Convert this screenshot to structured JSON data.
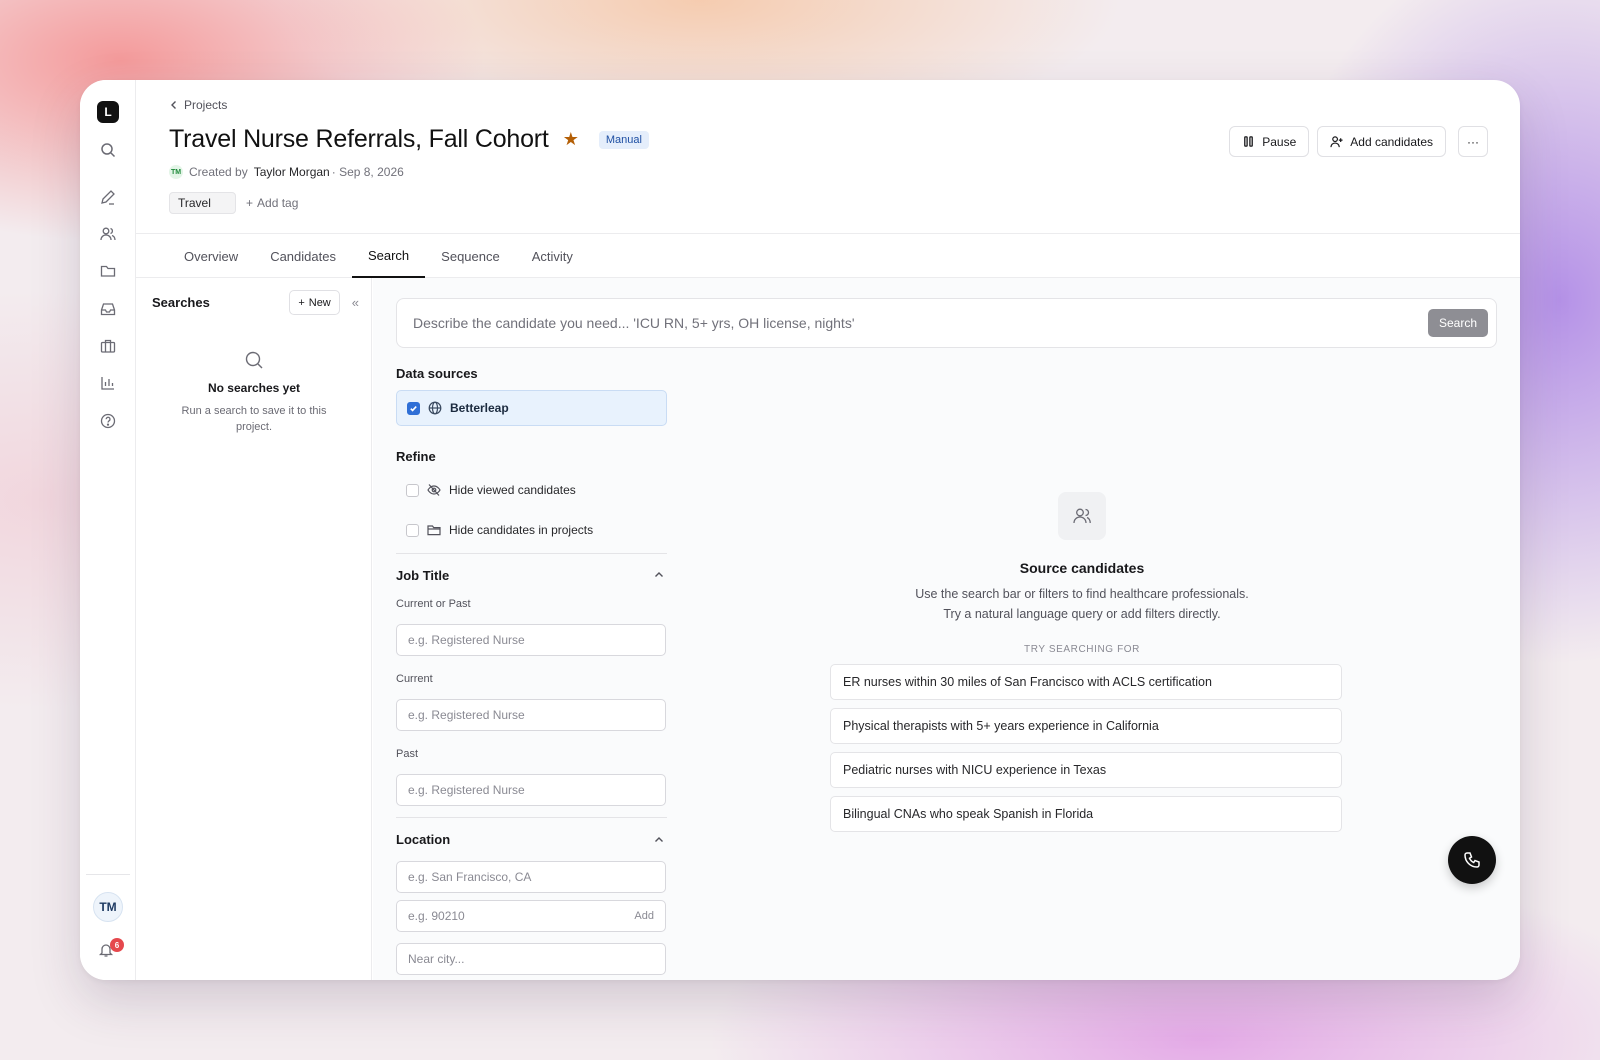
{
  "app": {
    "logo_letter": "L"
  },
  "rail": {
    "icons": [
      "search-icon",
      "pencil-icon",
      "users-icon",
      "folder-icon",
      "inbox-icon",
      "briefcase-icon",
      "bar-chart-icon",
      "help-icon"
    ],
    "user_initials": "TM",
    "notification_count": "6"
  },
  "header": {
    "breadcrumb": "Projects",
    "title": "Travel Nurse Referrals, Fall Cohort",
    "badge": "Manual",
    "creator_initials": "TM",
    "created_by_prefix": "Created by",
    "creator_name": "Taylor Morgan",
    "created_date": "· Sep 8, 2026",
    "tag": "Travel",
    "add_tag": "Add tag",
    "pause_label": "Pause",
    "add_candidates_label": "Add candidates",
    "more_label": "···"
  },
  "tabs": [
    {
      "label": "Overview",
      "active": false
    },
    {
      "label": "Candidates",
      "active": false
    },
    {
      "label": "Search",
      "active": true
    },
    {
      "label": "Sequence",
      "active": false
    },
    {
      "label": "Activity",
      "active": false
    }
  ],
  "searches": {
    "title": "Searches",
    "new_label": "New",
    "collapse_label": "«",
    "empty_title": "No searches yet",
    "empty_sub": "Run a search to save it to this project."
  },
  "search": {
    "placeholder": "Describe the candidate you need... 'ICU RN, 5+ yrs, OH license, nights'",
    "button": "Search"
  },
  "filters": {
    "data_sources_label": "Data sources",
    "source": {
      "label": "Betterleap",
      "checked": true
    },
    "refine_label": "Refine",
    "refine_options": [
      {
        "label": "Hide viewed candidates",
        "checked": false
      },
      {
        "label": "Hide candidates in projects",
        "checked": false
      }
    ],
    "job_title": {
      "label": "Job Title",
      "current_or_past_label": "Current or Past",
      "current_or_past_placeholder": "e.g. Registered Nurse",
      "current_label": "Current",
      "current_placeholder": "e.g. Registered Nurse",
      "past_label": "Past",
      "past_placeholder": "e.g. Registered Nurse"
    },
    "location": {
      "label": "Location",
      "city_placeholder": "e.g. San Francisco, CA",
      "zip_placeholder": "e.g. 90210",
      "zip_add": "Add",
      "near_placeholder": "Near city..."
    }
  },
  "empty_state": {
    "title": "Source candidates",
    "line1": "Use the search bar or filters to find healthcare professionals.",
    "line2": "Try a natural language query or add filters directly.",
    "try_label": "TRY SEARCHING FOR",
    "suggestions": [
      "ER nurses within 30 miles of San Francisco with ACLS certification",
      "Physical therapists with 5+ years experience in California",
      "Pediatric nurses with NICU experience in Texas",
      "Bilingual CNAs who speak Spanish in Florida"
    ]
  },
  "colors": {
    "accent": "#2f6fd6",
    "star": "#b45f06",
    "badge_bg": "#e5eefb",
    "alert": "#e5484d"
  }
}
